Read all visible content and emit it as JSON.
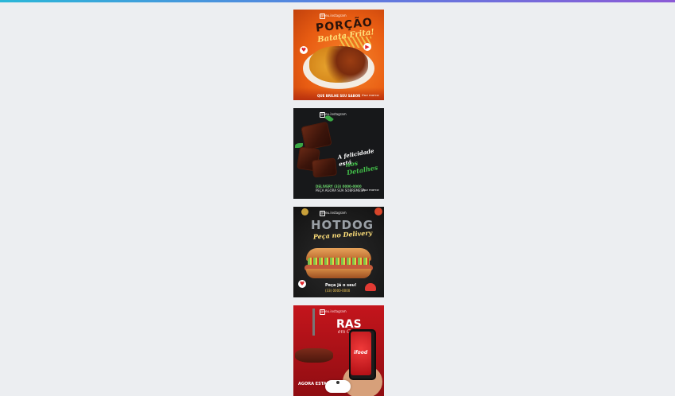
{
  "colors": {
    "accent_gradient": [
      "#2ab7d8",
      "#8b5ad6"
    ],
    "background": "#eceef1"
  },
  "cards": [
    {
      "handle": "@seu.instagram",
      "title": "PORÇÃO",
      "subtitle": "Batata Frita!",
      "footer_line1": "",
      "footer_line2": "QUE BRILHE SEU SABOR",
      "signature": "Sua marca"
    },
    {
      "handle": "@seu.instagram",
      "title_line1": "A felicidade está",
      "title_line2": "nos Detalhes",
      "delivery": "DELIVERY (33) 0000-0000",
      "footer": "PEÇA AGORA SUA SOBREMESA",
      "signature": "Sua marca"
    },
    {
      "handle": "@seu.instagram",
      "title": "HOTDOG",
      "subtitle": "Peça no Delivery",
      "order_text": "Peça já o seu!",
      "phone": "(33) 0000-0000"
    },
    {
      "handle": "@seu.instagram",
      "title": "RAS",
      "subtitle": "em Casa",
      "app": "ifood",
      "footer": "AGORA ESTAMOS"
    }
  ],
  "icons": {
    "like": "heart-icon",
    "instagram": "instagram-icon"
  }
}
